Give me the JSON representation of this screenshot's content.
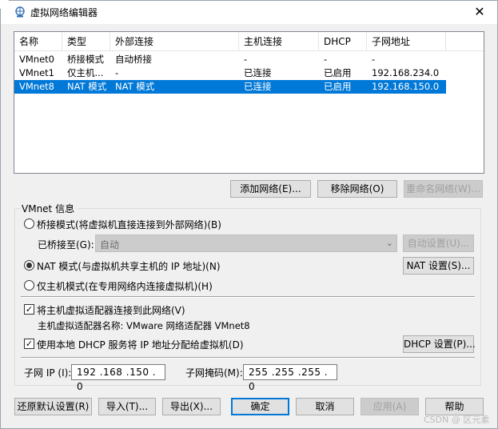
{
  "window": {
    "title": "虚拟网络编辑器",
    "close_glyph": "✕",
    "icon": "network-globe-icon"
  },
  "network_list": {
    "headers": [
      "名称",
      "类型",
      "外部连接",
      "主机连接",
      "DHCP",
      "子网地址"
    ],
    "rows": [
      {
        "name": "VMnet0",
        "type": "桥接模式",
        "external": "自动桥接",
        "host": "-",
        "dhcp": "-",
        "subnet": "-",
        "selected": false
      },
      {
        "name": "VMnet1",
        "type": "仅主机...",
        "external": "-",
        "host": "已连接",
        "dhcp": "已启用",
        "subnet": "192.168.234.0",
        "selected": false
      },
      {
        "name": "VMnet8",
        "type": "NAT 模式",
        "external": "NAT 模式",
        "host": "已连接",
        "dhcp": "已启用",
        "subnet": "192.168.150.0",
        "selected": true
      }
    ]
  },
  "list_buttons": {
    "add": "添加网络(E)...",
    "remove": "移除网络(O)",
    "rename": "重命名网络(W)..."
  },
  "vmnet_info": {
    "group_title": "VMnet 信息",
    "bridged_label": "桥接模式(将虚拟机直接连接到外部网络)(B)",
    "bridged_to_label": "已桥接至(G):",
    "bridged_to_value": "自动",
    "auto_settings": "自动设置(U)...",
    "nat_label": "NAT 模式(与虚拟机共享主机的 IP 地址)(N)",
    "nat_settings": "NAT 设置(S)...",
    "host_only_label": "仅主机模式(在专用网络内连接虚拟机)(H)",
    "selected_mode": "nat",
    "connect_adapter_label": "将主机虚拟适配器连接到此网络(V)",
    "connect_adapter_checked": true,
    "adapter_name_label": "主机虚拟适配器名称: VMware 网络适配器 VMnet8",
    "use_dhcp_label": "使用本地 DHCP 服务将 IP 地址分配给虚拟机(D)",
    "use_dhcp_checked": true,
    "dhcp_settings": "DHCP 设置(P)...",
    "subnet_ip_label": "子网 IP (I):",
    "subnet_ip_value": "192 .168 .150 . 0",
    "subnet_mask_label": "子网掩码(M):",
    "subnet_mask_value": "255 .255 .255 . 0"
  },
  "bottom_buttons": {
    "restore": "还原默认设置(R)",
    "import": "导入(T)...",
    "export": "导出(X)...",
    "ok": "确定",
    "cancel": "取消",
    "apply": "应用(A)",
    "help": "帮助"
  },
  "watermark": "CSDN @ 区元素",
  "colors": {
    "selection": "#0078d7",
    "dialog_bg": "#f0f0f0",
    "disabled_text": "#a0a0a0"
  }
}
